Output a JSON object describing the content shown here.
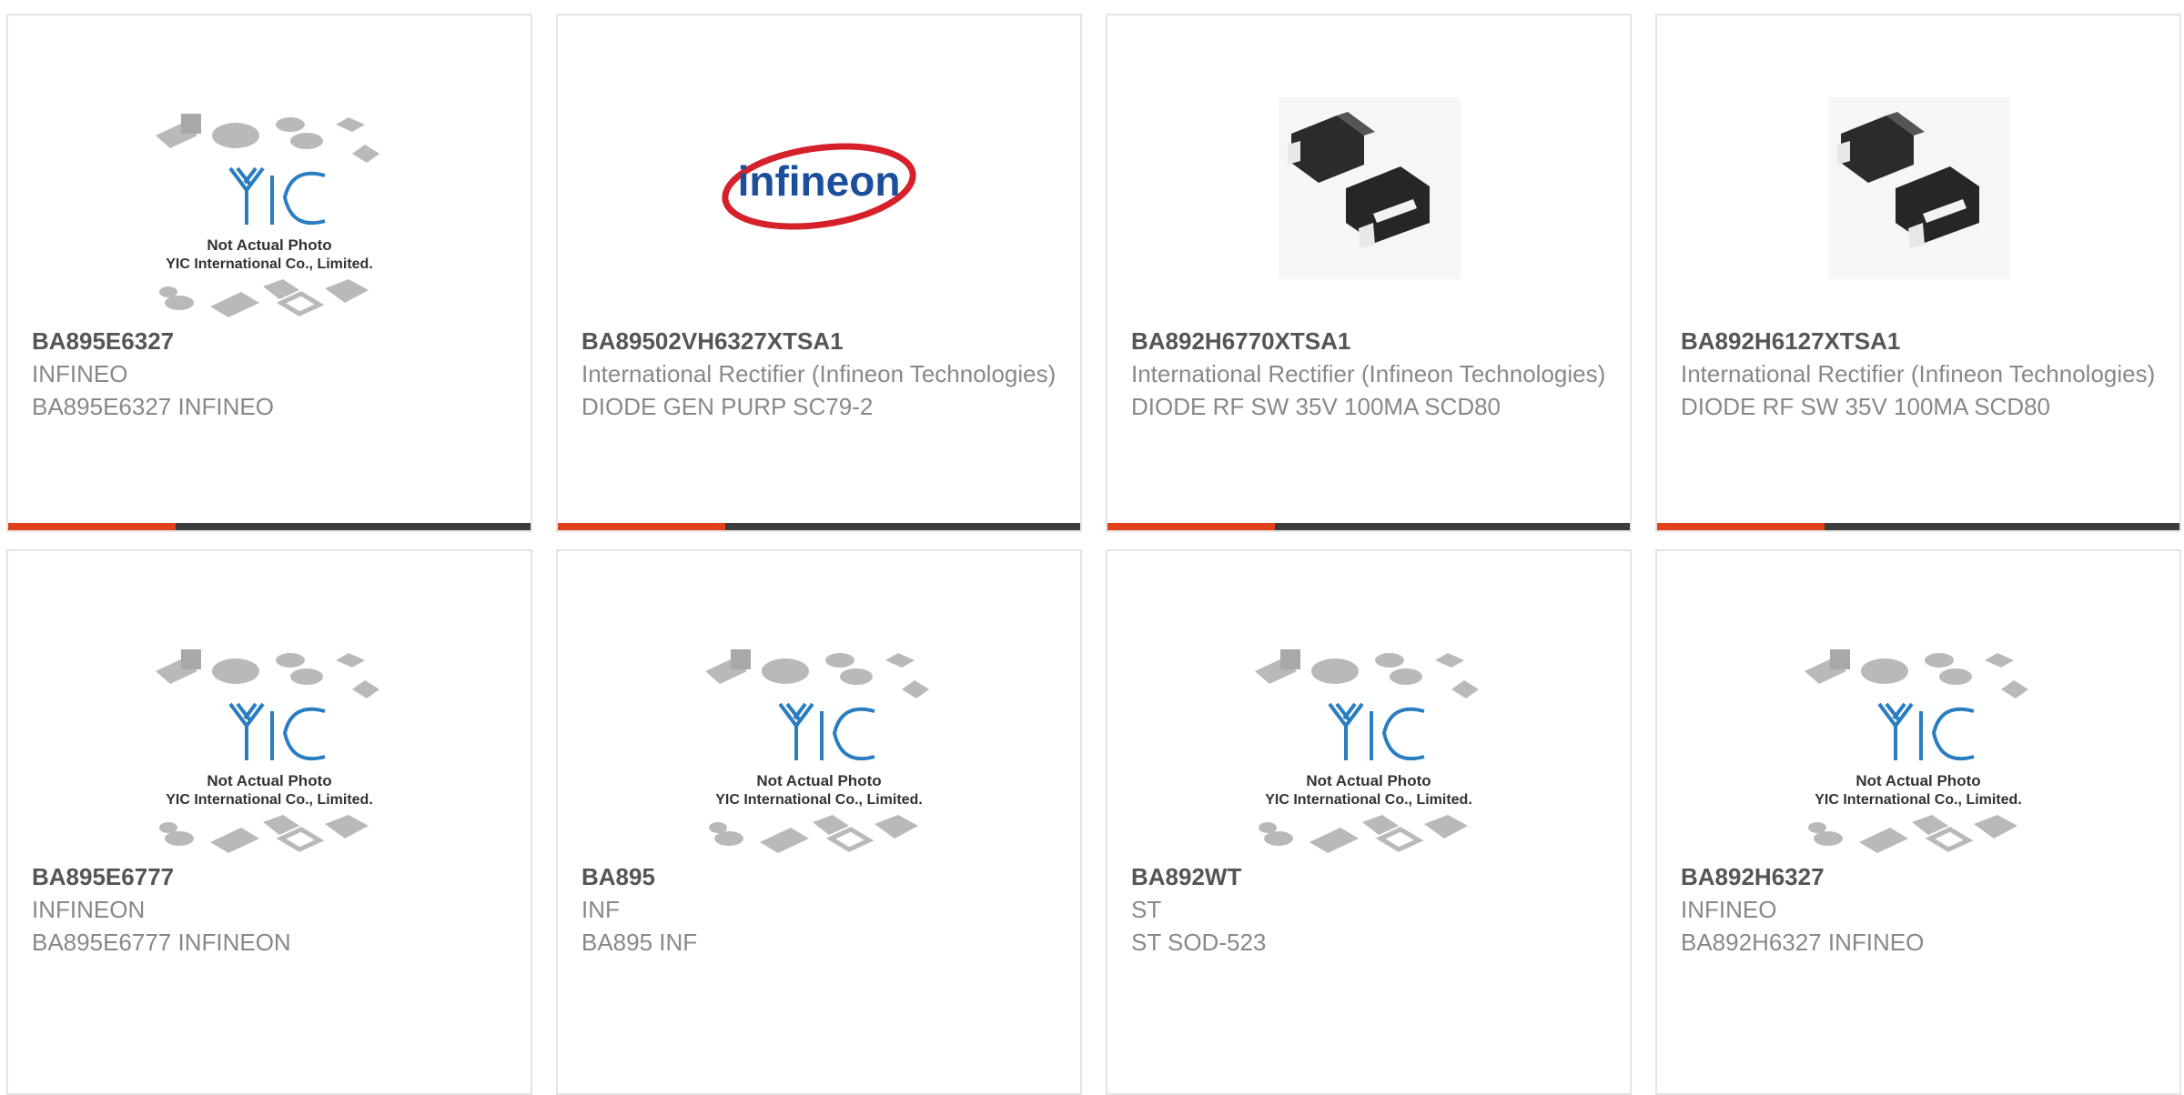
{
  "cards": [
    {
      "part": "BA895E6327",
      "maker": "INFINEO",
      "desc": "BA895E6327 INFINEO",
      "image": "placeholder",
      "note": "Not Actual Photo",
      "company": "YIC International Co., Limited.",
      "logo_text": "YIC"
    },
    {
      "part": "BA89502VH6327XTSA1",
      "maker": "International Rectifier (Infineon Technologies)",
      "desc": "DIODE GEN PURP SC79-2",
      "image": "infineon-logo",
      "logo_text": "infineon"
    },
    {
      "part": "BA892H6770XTSA1",
      "maker": "International Rectifier (Infineon Technologies)",
      "desc": "DIODE RF SW 35V 100MA SCD80",
      "image": "diode-photo"
    },
    {
      "part": "BA892H6127XTSA1",
      "maker": "International Rectifier (Infineon Technologies)",
      "desc": "DIODE RF SW 35V 100MA SCD80",
      "image": "diode-photo"
    },
    {
      "part": "BA895E6777",
      "maker": "INFINEON",
      "desc": "BA895E6777 INFINEON",
      "image": "placeholder",
      "note": "Not Actual Photo",
      "company": "YIC International Co., Limited.",
      "logo_text": "YIC"
    },
    {
      "part": "BA895",
      "maker": "INF",
      "desc": "BA895 INF",
      "image": "placeholder",
      "note": "Not Actual Photo",
      "company": "YIC International Co., Limited.",
      "logo_text": "YIC"
    },
    {
      "part": "BA892WT",
      "maker": "ST",
      "desc": "ST SOD-523",
      "image": "placeholder",
      "note": "Not Actual Photo",
      "company": "YIC International Co., Limited.",
      "logo_text": "YIC"
    },
    {
      "part": "BA892H6327",
      "maker": "INFINEO",
      "desc": "BA892H6327 INFINEO",
      "image": "placeholder",
      "note": "Not Actual Photo",
      "company": "YIC International Co., Limited.",
      "logo_text": "YIC"
    }
  ],
  "colors": {
    "accent": "#e2401a",
    "bar": "#3c3c3c",
    "yic_blue": "#2a7dc0",
    "infineon_red": "#d6202a",
    "infineon_blue": "#1b4f9c"
  }
}
